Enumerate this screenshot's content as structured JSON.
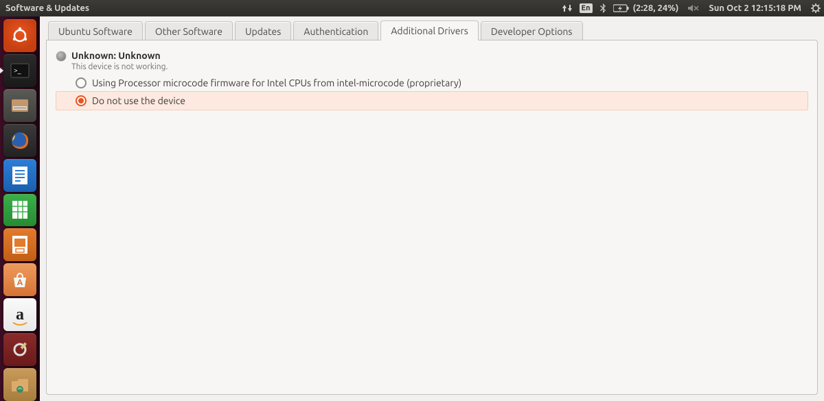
{
  "menubar": {
    "window_title": "Software & Updates",
    "language_code": "En",
    "battery_text": "(2:28, 24%)",
    "clock_text": "Sun Oct  2 12:15:18 PM"
  },
  "launcher": {
    "items": [
      {
        "name": "dash",
        "glyph": "⌂"
      },
      {
        "name": "terminal",
        "glyph": ">_"
      },
      {
        "name": "files",
        "glyph": "▭"
      },
      {
        "name": "firefox",
        "glyph": ""
      },
      {
        "name": "writer",
        "glyph": "≡"
      },
      {
        "name": "calc",
        "glyph": "▦"
      },
      {
        "name": "impress",
        "glyph": "▣"
      },
      {
        "name": "software-center",
        "glyph": "A"
      },
      {
        "name": "amazon",
        "glyph": "a"
      },
      {
        "name": "settings",
        "glyph": "⚙"
      },
      {
        "name": "files-home",
        "glyph": "◧"
      }
    ]
  },
  "tabs": [
    {
      "id": "ubuntu-software",
      "label": "Ubuntu Software",
      "active": false
    },
    {
      "id": "other-software",
      "label": "Other Software",
      "active": false
    },
    {
      "id": "updates",
      "label": "Updates",
      "active": false
    },
    {
      "id": "authentication",
      "label": "Authentication",
      "active": false
    },
    {
      "id": "additional-drivers",
      "label": "Additional Drivers",
      "active": true
    },
    {
      "id": "developer-options",
      "label": "Developer Options",
      "active": false
    }
  ],
  "device": {
    "title": "Unknown: Unknown",
    "subtitle": "This device is not working.",
    "options": [
      {
        "label": "Using Processor microcode firmware for Intel CPUs from intel-microcode (proprietary)",
        "selected": false
      },
      {
        "label": "Do not use the device",
        "selected": true
      }
    ]
  }
}
